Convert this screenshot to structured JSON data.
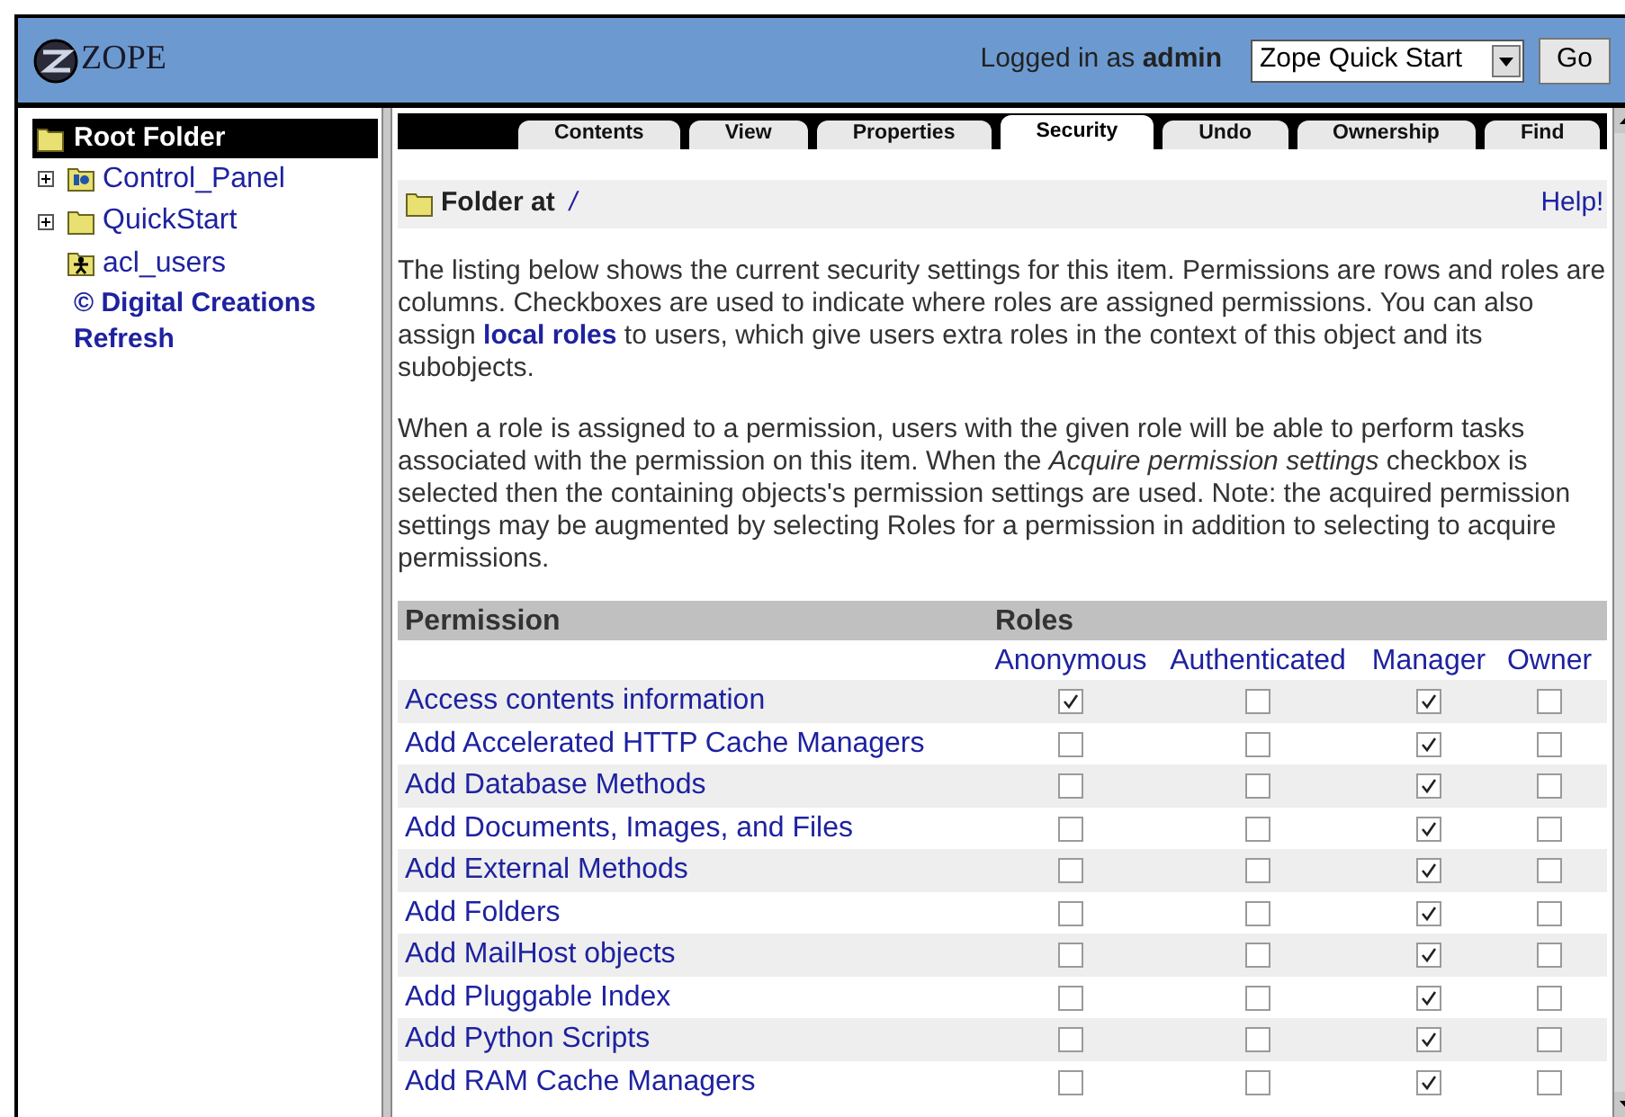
{
  "header": {
    "logo_text": "ZOPE",
    "login_label": "Logged in as",
    "user": "admin",
    "view_select": {
      "value": "Zope Quick Start"
    },
    "go_button": "Go"
  },
  "tree": {
    "root": "Root Folder",
    "items": [
      {
        "label": "Control_Panel",
        "kind": "control-panel",
        "expandable": true
      },
      {
        "label": "QuickStart",
        "kind": "folder",
        "expandable": true
      },
      {
        "label": "acl_users",
        "kind": "user-folder",
        "expandable": false
      }
    ],
    "credit": "© Digital Creations",
    "refresh": "Refresh"
  },
  "tabs": [
    {
      "label": "Contents",
      "selected": false
    },
    {
      "label": "View",
      "selected": false
    },
    {
      "label": "Properties",
      "selected": false
    },
    {
      "label": "Security",
      "selected": true
    },
    {
      "label": "Undo",
      "selected": false
    },
    {
      "label": "Ownership",
      "selected": false
    },
    {
      "label": "Find",
      "selected": false
    }
  ],
  "folder_header": {
    "label": "Folder at",
    "path": "/",
    "help": "Help!"
  },
  "intro": {
    "before": "The listing below shows the current security settings for this item. Permissions are rows and roles are columns. Checkboxes are used to indicate where roles are assigned permissions. You can also assign",
    "link": "local roles",
    "after": "to users, which give users extra roles in the context of this object and its subobjects."
  },
  "note": "When a role is assigned to a permission, users with the given role will be able to perform tasks associated with the permission on this item. When the *Acquire permission settings* checkbox is selected then the containing objects's permission settings are used. Note: the acquired permission settings may be augmented by selecting Roles for a permission in addition to selecting to acquire permissions.",
  "table": {
    "permission_heading": "Permission",
    "roles_heading": "Roles",
    "roles": [
      "Anonymous",
      "Authenticated",
      "Manager",
      "Owner"
    ],
    "rows": [
      {
        "name": "Access contents information",
        "checks": [
          true,
          false,
          true,
          false
        ]
      },
      {
        "name": "Add Accelerated HTTP Cache Managers",
        "checks": [
          false,
          false,
          true,
          false
        ]
      },
      {
        "name": "Add Database Methods",
        "checks": [
          false,
          false,
          true,
          false
        ]
      },
      {
        "name": "Add Documents, Images, and Files",
        "checks": [
          false,
          false,
          true,
          false
        ]
      },
      {
        "name": "Add External Methods",
        "checks": [
          false,
          false,
          true,
          false
        ]
      },
      {
        "name": "Add Folders",
        "checks": [
          false,
          false,
          true,
          false
        ]
      },
      {
        "name": "Add MailHost objects",
        "checks": [
          false,
          false,
          true,
          false
        ]
      },
      {
        "name": "Add Pluggable Index",
        "checks": [
          false,
          false,
          true,
          false
        ]
      },
      {
        "name": "Add Python Scripts",
        "checks": [
          false,
          false,
          true,
          false
        ]
      },
      {
        "name": "Add RAM Cache Managers",
        "checks": [
          false,
          false,
          true,
          false
        ]
      }
    ]
  }
}
